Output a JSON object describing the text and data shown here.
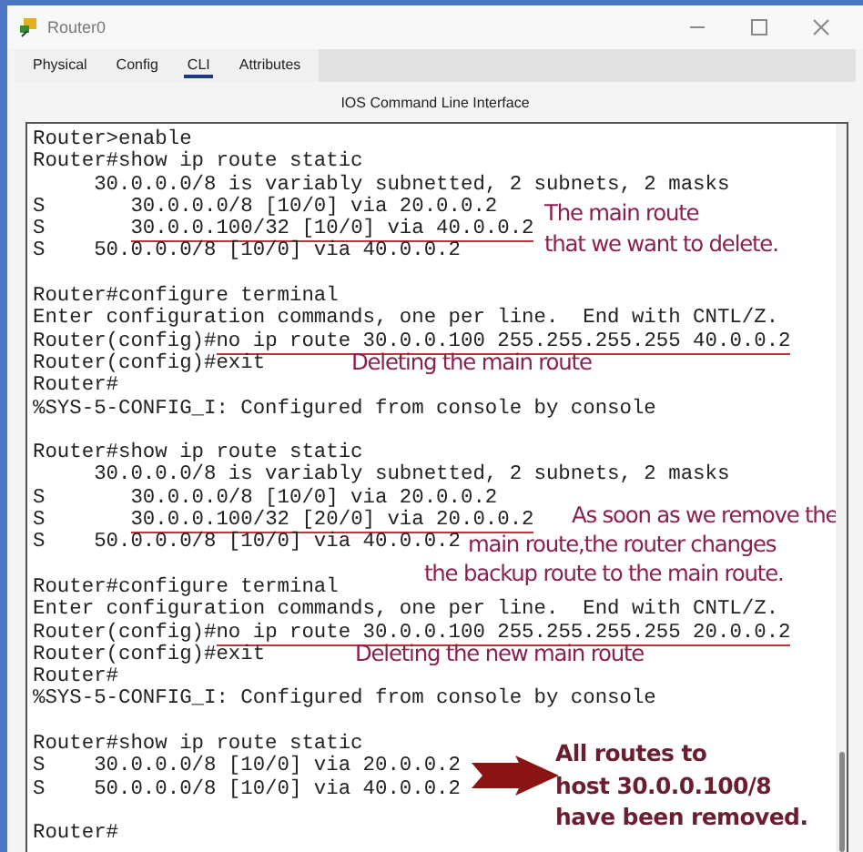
{
  "window": {
    "title": "Router0"
  },
  "tabs": [
    {
      "label": "Physical",
      "selected": false
    },
    {
      "label": "Config",
      "selected": false
    },
    {
      "label": "CLI",
      "selected": true
    },
    {
      "label": "Attributes",
      "selected": false
    }
  ],
  "panel_title": "IOS Command Line Interface",
  "terminal": {
    "lines": [
      {
        "kind": "text",
        "parts": [
          {
            "text": "Router>enable"
          }
        ]
      },
      {
        "kind": "text",
        "parts": [
          {
            "text": "Router#show ip route static"
          }
        ]
      },
      {
        "kind": "text",
        "parts": [
          {
            "text": "     30.0.0.0/8 is variably subnetted, 2 subnets, 2 masks"
          }
        ]
      },
      {
        "kind": "text",
        "parts": [
          {
            "text": "S       30.0.0.0/8 [10/0] via 20.0.0.2"
          }
        ]
      },
      {
        "kind": "text",
        "parts": [
          {
            "text": "S       "
          },
          {
            "text": "30.0.0.100/32 [10/0] via 40.0.0.2",
            "underlined": true
          }
        ]
      },
      {
        "kind": "text",
        "parts": [
          {
            "text": "S    50.0.0.0/8 [10/0] via 40.0.0.2"
          }
        ]
      },
      {
        "kind": "blank"
      },
      {
        "kind": "text",
        "parts": [
          {
            "text": "Router#configure terminal"
          }
        ]
      },
      {
        "kind": "text",
        "parts": [
          {
            "text": "Enter configuration commands, one per line.  End with CNTL/Z."
          }
        ]
      },
      {
        "kind": "text",
        "parts": [
          {
            "text": "Router(config)#"
          },
          {
            "text": "no ip route 30.0.0.100 255.255.255.255 40.0.0.2",
            "underlined": true
          }
        ]
      },
      {
        "kind": "text",
        "parts": [
          {
            "text": "Router(config)#exit"
          }
        ]
      },
      {
        "kind": "text",
        "parts": [
          {
            "text": "Router#"
          }
        ]
      },
      {
        "kind": "text",
        "parts": [
          {
            "text": "%SYS-5-CONFIG_I: Configured from console by console"
          }
        ]
      },
      {
        "kind": "blank"
      },
      {
        "kind": "text",
        "parts": [
          {
            "text": "Router#show ip route static"
          }
        ]
      },
      {
        "kind": "text",
        "parts": [
          {
            "text": "     30.0.0.0/8 is variably subnetted, 2 subnets, 2 masks"
          }
        ]
      },
      {
        "kind": "text",
        "parts": [
          {
            "text": "S       30.0.0.0/8 [10/0] via 20.0.0.2"
          }
        ]
      },
      {
        "kind": "text",
        "parts": [
          {
            "text": "S       "
          },
          {
            "text": "30.0.0.100/32 [20/0] via 20.0.0.2",
            "underlined": true
          }
        ]
      },
      {
        "kind": "text",
        "parts": [
          {
            "text": "S    50.0.0.0/8 [10/0] via 40.0.0.2"
          }
        ]
      },
      {
        "kind": "blank"
      },
      {
        "kind": "text",
        "parts": [
          {
            "text": "Router#configure terminal"
          }
        ]
      },
      {
        "kind": "text",
        "parts": [
          {
            "text": "Enter configuration commands, one per line.  End with CNTL/Z."
          }
        ]
      },
      {
        "kind": "text",
        "parts": [
          {
            "text": "Router(config)#"
          },
          {
            "text": "no ip route 30.0.0.100 255.255.255.255 20.0.0.2",
            "underlined": true
          }
        ]
      },
      {
        "kind": "text",
        "parts": [
          {
            "text": "Router(config)#exit"
          }
        ]
      },
      {
        "kind": "text",
        "parts": [
          {
            "text": "Router#"
          }
        ]
      },
      {
        "kind": "text",
        "parts": [
          {
            "text": "%SYS-5-CONFIG_I: Configured from console by console"
          }
        ]
      },
      {
        "kind": "blank"
      },
      {
        "kind": "text",
        "parts": [
          {
            "text": "Router#show ip route static"
          }
        ]
      },
      {
        "kind": "text",
        "parts": [
          {
            "text": "S    30.0.0.0/8 [10/0] via 20.0.0.2"
          }
        ]
      },
      {
        "kind": "text",
        "parts": [
          {
            "text": "S    50.0.0.0/8 [10/0] via 40.0.0.2"
          }
        ]
      },
      {
        "kind": "blank"
      },
      {
        "kind": "text",
        "parts": [
          {
            "text": "Router#"
          }
        ]
      }
    ]
  },
  "annotations": [
    {
      "kind": "note",
      "lines": [
        "The main route",
        "that we want to delete."
      ]
    },
    {
      "kind": "note",
      "lines": [
        "Deleting the main route"
      ]
    },
    {
      "kind": "note",
      "lines": [
        "As soon as we remove the",
        "main route,the router changes",
        "the backup route to the main route."
      ]
    },
    {
      "kind": "note",
      "lines": [
        "Deleting the new main route"
      ]
    },
    {
      "kind": "callout",
      "lines": [
        "All routes to",
        "host 30.0.0.100/8",
        "have been removed."
      ]
    }
  ]
}
